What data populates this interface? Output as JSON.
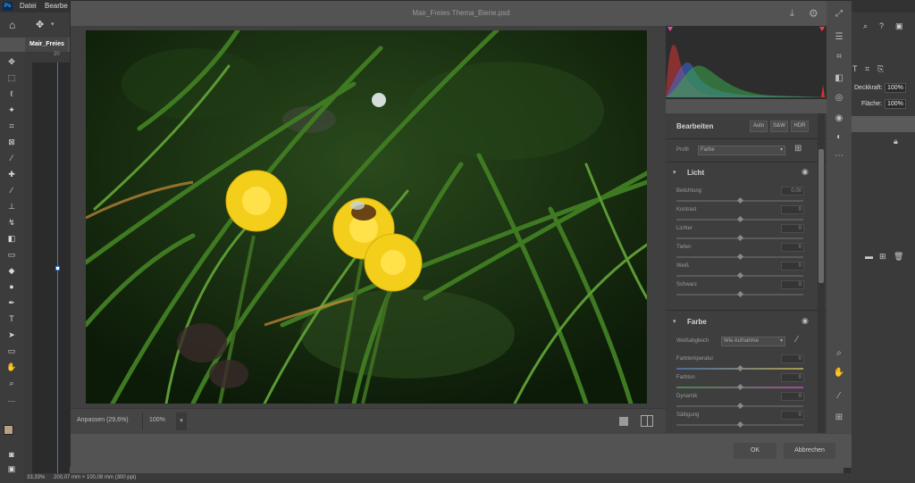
{
  "menubar": {
    "logo": "Ps",
    "items": [
      "Datei",
      "Bearbe"
    ]
  },
  "document": {
    "tab_title": "Mair_Freies",
    "ruler_mark": "20"
  },
  "status": {
    "zoom": "33,33%",
    "doc_info": "200,07 mm × 100,08 mm (300 ppi)"
  },
  "right_panel": {
    "opacity_label": "Deckkraft:",
    "opacity_value": "100%",
    "fill_label": "Fläche:",
    "fill_value": "100%"
  },
  "dialog": {
    "title": "Mair_Freies Thema_Biene.psd",
    "zoom_fit_label": "Anpassen (29,6%)",
    "zoom_value": "100%",
    "ok_label": "OK",
    "cancel_label": "Abbrechen"
  },
  "edit": {
    "title": "Bearbeiten",
    "auto_label": "Auto",
    "bw_label": "S&W",
    "hdr_label": "HDR",
    "profile_label": "Profil",
    "profile_value": "Farbe",
    "light": {
      "title": "Licht",
      "sliders": [
        {
          "label": "Belichtung",
          "value": "0,00"
        },
        {
          "label": "Kontrast",
          "value": "0"
        },
        {
          "label": "Lichter",
          "value": "0"
        },
        {
          "label": "Tiefen",
          "value": "0"
        },
        {
          "label": "Weiß",
          "value": "0"
        },
        {
          "label": "Schwarz",
          "value": "0"
        }
      ]
    },
    "color": {
      "title": "Farbe",
      "wb_label": "Weißabgleich",
      "wb_value": "Wie Aufnahme",
      "sliders": [
        {
          "label": "Farbtemperatur",
          "value": "0"
        },
        {
          "label": "Farbton",
          "value": "0"
        },
        {
          "label": "Dynamik",
          "value": "0"
        },
        {
          "label": "Sättigung",
          "value": "0"
        }
      ]
    }
  },
  "icons": {
    "home": "home-icon",
    "move": "move-icon",
    "download": "save-image-icon",
    "settings": "gear-icon",
    "expand": "expand-icon",
    "eye": "eye-icon"
  },
  "colors": {
    "accent": "#4a4a4a",
    "clip_shadow": "#e0509f",
    "clip_highlight": "#ff3a3a"
  }
}
